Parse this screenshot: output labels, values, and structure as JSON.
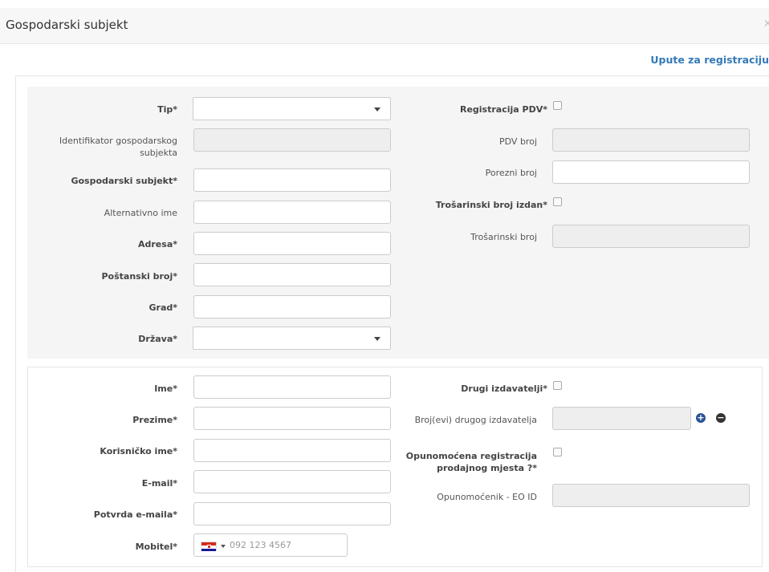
{
  "header": {
    "title": "Gospodarski subjekt",
    "close": "×"
  },
  "help_link": "Upute za registraciju",
  "section1": {
    "tip_label": "Tip*",
    "identifikator_label": "Identifikator gospodarskog subjekta",
    "gospodarski_subjekt_label": "Gospodarski subjekt*",
    "alternativno_ime_label": "Alternativno ime",
    "adresa_label": "Adresa*",
    "postanski_broj_label": "Poštanski broj*",
    "grad_label": "Grad*",
    "drzava_label": "Država*",
    "registracija_pdv_label": "Registracija PDV*",
    "pdv_broj_label": "PDV broj",
    "porezni_broj_label": "Porezni broj",
    "trosarinski_izdan_label": "Trošarinski broj izdan*",
    "trosarinski_broj_label": "Trošarinski broj"
  },
  "section2": {
    "ime_label": "Ime*",
    "prezime_label": "Prezime*",
    "korisnicko_ime_label": "Korisničko ime*",
    "email_label": "E-mail*",
    "potvrda_email_label": "Potvrda e-maila*",
    "mobitel_label": "Mobitel*",
    "mobitel_placeholder": "092 123 4567",
    "drugi_izdavatelji_label": "Drugi izdavatelji*",
    "broj_drugog_label": "Broj(evi) drugog izdavatelja",
    "opunomocena_label": "Opunomoćena registracija prodajnog mjesta ?*",
    "opunomocenik_label": "Opunomoćenik - EO ID"
  },
  "icons": {
    "plus": "plus-icon",
    "minus": "minus-icon",
    "flag": "croatia-flag-icon"
  },
  "colors": {
    "link": "#337ab7",
    "panel_bg": "#f5f5f5",
    "plus": "#2a5494"
  }
}
